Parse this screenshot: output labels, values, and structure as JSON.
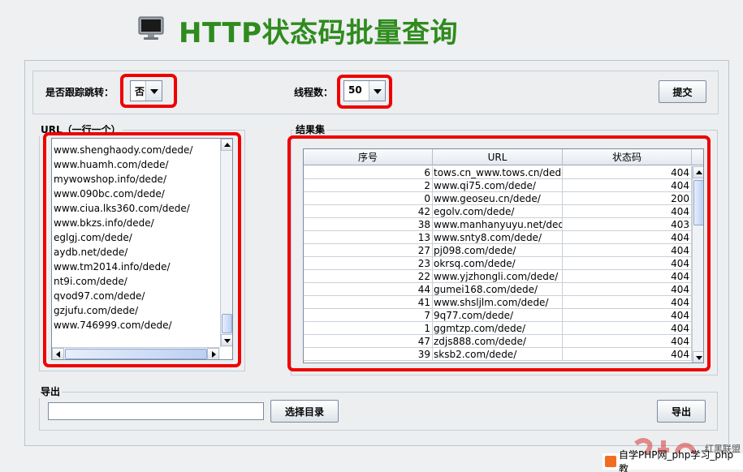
{
  "header": {
    "title": "HTTP状态码批量查询",
    "icon": "monitor-icon"
  },
  "options": {
    "follow_redirect_label": "是否跟踪跳转：",
    "follow_redirect_value": "否",
    "threads_label": "线程数：",
    "threads_value": "50",
    "submit_label": "提交"
  },
  "url_panel": {
    "title": "URL（一行一个）",
    "urls": [
      "www.shenghaody.com/dede/",
      "www.huamh.com/dede/",
      "mywowshop.info/dede/",
      "www.090bc.com/dede/",
      "www.ciua.lks360.com/dede/",
      "www.bkzs.info/dede/",
      "eglgj.com/dede/",
      "aydb.net/dede/",
      "www.tm2014.info/dede/",
      "nt9i.com/dede/",
      "qvod97.com/dede/",
      "gzjufu.com/dede/",
      "www.746999.com/dede/"
    ]
  },
  "result_panel": {
    "title": "结果集",
    "columns": [
      "序号",
      "URL",
      "状态码"
    ],
    "rows": [
      [
        "6",
        "tows.cn_www.tows.cn/dede/",
        "404"
      ],
      [
        "2",
        "www.qi75.com/dede/",
        "404"
      ],
      [
        "0",
        "www.geoseu.cn/dede/",
        "200"
      ],
      [
        "42",
        "egolv.com/dede/",
        "404"
      ],
      [
        "38",
        "www.manhanyuyu.net/dede/",
        "403"
      ],
      [
        "13",
        "www.snty8.com/dede/",
        "404"
      ],
      [
        "27",
        "pj098.com/dede/",
        "404"
      ],
      [
        "23",
        "okrsq.com/dede/",
        "404"
      ],
      [
        "22",
        "www.yjzhongli.com/dede/",
        "404"
      ],
      [
        "44",
        "gumei168.com/dede/",
        "404"
      ],
      [
        "41",
        "www.shsljlm.com/dede/",
        "404"
      ],
      [
        "7",
        "9q77.com/dede/",
        "404"
      ],
      [
        "1",
        "ggmtzp.com/dede/",
        "404"
      ],
      [
        "47",
        "zdjs888.com/dede/",
        "404"
      ],
      [
        "39",
        "sksb2.com/dede/",
        "404"
      ]
    ]
  },
  "export_panel": {
    "title": "导出",
    "path_value": "",
    "choose_dir_label": "选择目录",
    "export_label": "导出"
  },
  "watermark": {
    "cn_label": "红黑联盟",
    "bottom_text": "自学PHP网_php学习_php教"
  },
  "colors": {
    "title_green": "#2f8b1d",
    "highlight_red": "#ee0000"
  }
}
